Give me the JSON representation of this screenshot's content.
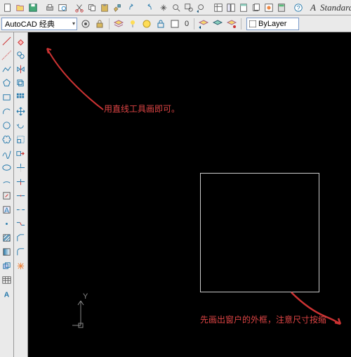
{
  "topbar": {
    "standard_label": "Standard"
  },
  "row2": {
    "workspace": "AutoCAD 经典",
    "layer_current": "ByLayer"
  },
  "annotations": {
    "line1": "用直线工具画即可。",
    "line2": "先画出窗户的外框，注意尺寸按缩"
  },
  "ucs": {
    "y_label": "Y"
  },
  "tools_left": [
    "line",
    "construction-line",
    "polyline",
    "polygon",
    "rectangle",
    "arc",
    "circle",
    "revision-cloud",
    "spline",
    "ellipse",
    "ellipse-arc",
    "insert-block",
    "make-block",
    "point",
    "hatch",
    "gradient",
    "region",
    "table",
    "multiline-text"
  ],
  "tools_right": [
    "erase",
    "copy",
    "mirror",
    "offset",
    "array",
    "move",
    "rotate",
    "scale",
    "stretch",
    "trim",
    "extend",
    "break-at-point",
    "break",
    "join",
    "chamfer",
    "fillet",
    "explode"
  ]
}
